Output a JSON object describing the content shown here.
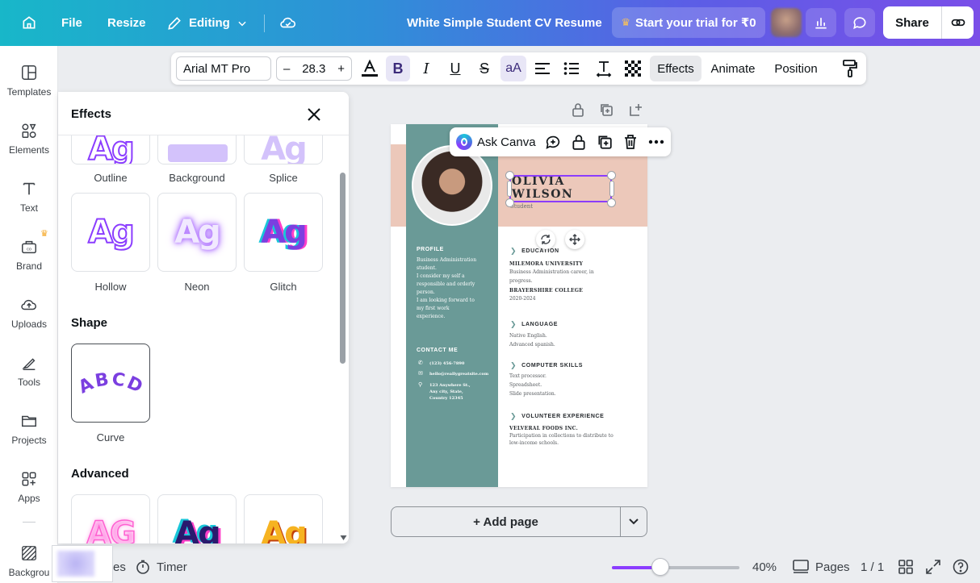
{
  "topbar": {
    "file": "File",
    "resize": "Resize",
    "editing": "Editing",
    "doc_title": "White Simple Student CV Resume",
    "trial": "Start your trial for ₹0",
    "share": "Share"
  },
  "sidebar": {
    "items": [
      {
        "label": "Templates",
        "icon": "templates-icon"
      },
      {
        "label": "Elements",
        "icon": "elements-icon"
      },
      {
        "label": "Text",
        "icon": "text-icon"
      },
      {
        "label": "Brand",
        "icon": "brand-icon"
      },
      {
        "label": "Uploads",
        "icon": "uploads-icon"
      },
      {
        "label": "Tools",
        "icon": "tools-icon"
      },
      {
        "label": "Projects",
        "icon": "projects-icon"
      },
      {
        "label": "Apps",
        "icon": "apps-icon"
      },
      {
        "label": "Backgrou",
        "icon": "background-icon"
      }
    ]
  },
  "toolbar": {
    "font": "Arial MT Pro",
    "font_size": "28.3",
    "minus": "–",
    "plus": "+",
    "case": "aA",
    "effects": "Effects",
    "animate": "Animate",
    "position": "Position"
  },
  "panel": {
    "title": "Effects",
    "style_row1": [
      "Outline",
      "Background",
      "Splice"
    ],
    "style_row2": [
      "Hollow",
      "Neon",
      "Glitch"
    ],
    "ag_text": "Ag",
    "shape_title": "Shape",
    "shape_item": "Curve",
    "curve_text": "ABCD",
    "advanced_title": "Advanced",
    "advanced_tiles": [
      "AG",
      "Ag",
      "Ag"
    ]
  },
  "context_bar": {
    "ask": "Ask Canva"
  },
  "cv": {
    "name_line1": "OLIVIA",
    "name_line2": "WILSON",
    "role": "Student",
    "profile_heading": "PROFILE",
    "profile_lines": [
      "Business Administration",
      "student.",
      "I consider my self a",
      "responsible and orderly",
      "person.",
      "I am looking forward to",
      "my first work",
      "experience."
    ],
    "contact_heading": "CONTACT ME",
    "phone": "(123) 456-7890",
    "email": "hello@reallygreatsite.com",
    "address_lines": [
      "123 Anywhere St.,",
      "Any city, State,",
      "Country 12345"
    ],
    "education_heading": "EDUCATION",
    "edu1_school": "MILEMORA UNIVERSITY",
    "edu1_lines": [
      "Business Administration career, in",
      "progress."
    ],
    "edu2_school": "BRAYERSHIRE COLLEGE",
    "edu2_years": "2020-2024",
    "language_heading": "LANGUAGE",
    "language_lines": [
      "Native English.",
      "Advanced spanish."
    ],
    "skills_heading": "COMPUTER SKILLS",
    "skills_lines": [
      "Text processor.",
      "Spreadsheet.",
      "Slide presentation."
    ],
    "volunteer_heading": "VOLUNTEER EXPERIENCE",
    "volunteer_org": "VELVERAL FOODS INC.",
    "volunteer_lines": [
      "Participation in collections to distribute to",
      "low-income schools."
    ]
  },
  "canvas": {
    "add_page": "+ Add page"
  },
  "bottombar": {
    "notes_partial": "es",
    "timer": "Timer",
    "zoom_value": 0.38,
    "zoom": "40%",
    "pages": "Pages",
    "page_count": "1 / 1"
  },
  "colors": {
    "accent": "#8b3dff",
    "teal": "#6a9a97",
    "peach": "#ecc8ba"
  }
}
